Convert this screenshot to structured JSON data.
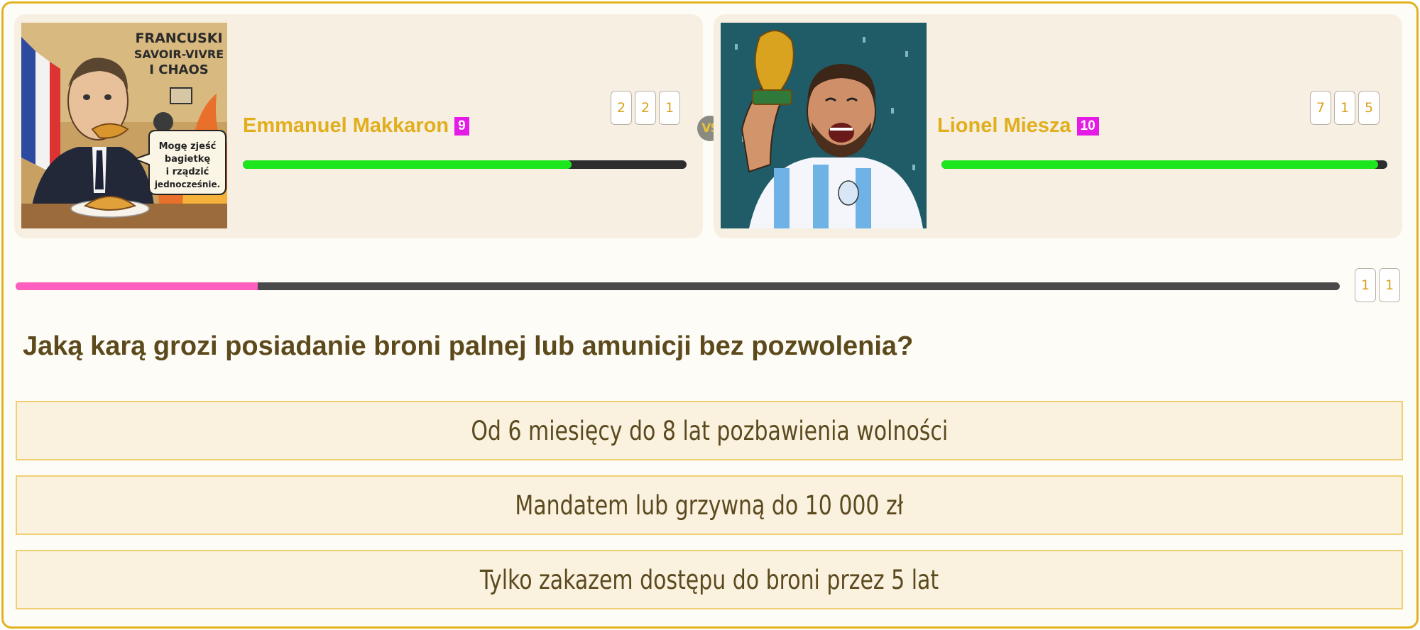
{
  "player1": {
    "name": "Emmanuel Makkaron",
    "level": "9",
    "score_digits": [
      "2",
      "2",
      "1"
    ],
    "hp_fraction": 0.74,
    "portrait": {
      "title_lines": [
        "FRANCUSKI",
        "SAVOIR-VIVRE",
        "I CHAOS"
      ],
      "bubble_lines": [
        "Mogę zjeść",
        "bagietkę",
        "i rządzić",
        "jednocześnie."
      ]
    }
  },
  "player2": {
    "name": "Lionel Miesza",
    "level": "10",
    "score_digits": [
      "7",
      "1",
      "5"
    ],
    "hp_fraction": 0.98
  },
  "vs_label": "VS",
  "timer": {
    "fraction": 0.183,
    "digits": [
      "1",
      "1"
    ]
  },
  "question": "Jaką karą grozi posiadanie broni palnej lub amunicji bez pozwolenia?",
  "answers": [
    "Od 6 miesięcy do 8 lat pozbawienia wolności",
    "Mandatem lub grzywną do 10 000 zł",
    "Tylko zakazem dostępu do broni przez 5 lat"
  ],
  "colors": {
    "accent": "#e1ae1d",
    "level_badge": "#e61ae6",
    "hp_fill": "#1ee61e",
    "timer_fill": "#ff5fbf",
    "question_text": "#5c4a1c"
  }
}
